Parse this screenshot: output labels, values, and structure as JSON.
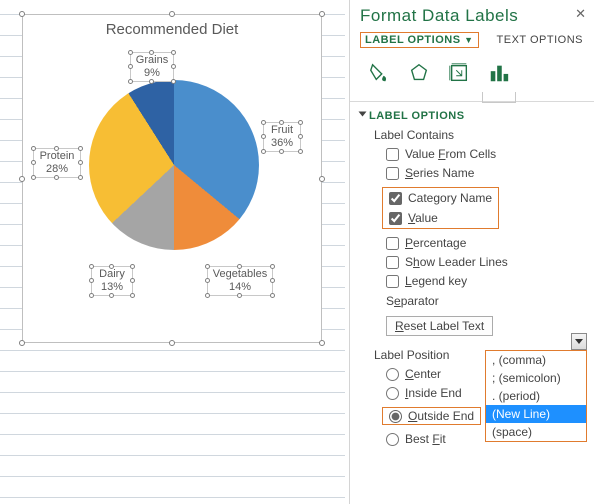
{
  "pane": {
    "title": "Format Data Labels",
    "tab_label_options": "LABEL OPTIONS",
    "tab_text_options": "TEXT OPTIONS",
    "section": "LABEL OPTIONS",
    "label_contains": "Label Contains",
    "chk_value_from_cells": "Value From Cells",
    "chk_series_name": "Series Name",
    "chk_category_name": "Category Name",
    "chk_value": "Value",
    "chk_percentage": "Percentage",
    "chk_leader_lines": "Show Leader Lines",
    "chk_legend_key": "Legend key",
    "separator_label": "Separator",
    "reset_btn": "Reset Label Text",
    "label_position": "Label Position",
    "rad_center": "Center",
    "rad_inside_end": "Inside End",
    "rad_outside_end": "Outside End",
    "rad_best_fit": "Best Fit",
    "separator_options": {
      "comma": ", (comma)",
      "semicolon": "; (semicolon)",
      "period": ". (period)",
      "newline": "(New Line)",
      "space": "  (space)"
    }
  },
  "chart_data": {
    "type": "pie",
    "title": "Recommended Diet",
    "series": [
      {
        "name": "Fruit",
        "value": 36,
        "label": "36%",
        "color": "#4a8ecc"
      },
      {
        "name": "Vegetables",
        "value": 14,
        "label": "14%",
        "color": "#ef8c3a"
      },
      {
        "name": "Dairy",
        "value": 13,
        "label": "13%",
        "color": "#a5a5a5"
      },
      {
        "name": "Protein",
        "value": 28,
        "label": "28%",
        "color": "#f7be34"
      },
      {
        "name": "Grains",
        "value": 9,
        "label": "9%",
        "color": "#2e62a4"
      }
    ]
  }
}
